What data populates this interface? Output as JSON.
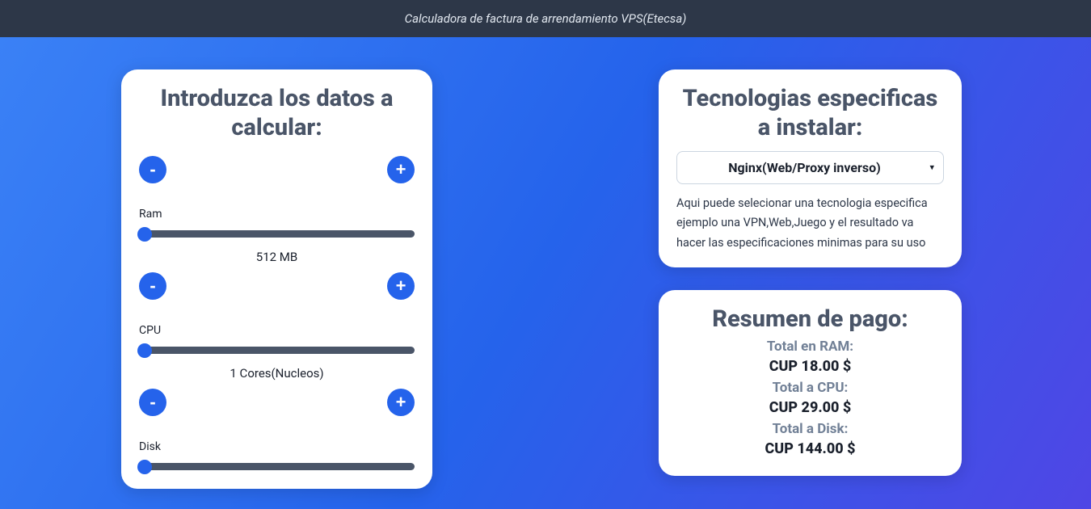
{
  "header": {
    "title": "Calculadora de factura de arrendamiento VPS(Etecsa)"
  },
  "inputPanel": {
    "heading": "Introduzca los datos a calcular:",
    "minus_label": "-",
    "plus_label": "+",
    "ram": {
      "label": "Ram",
      "value_text": "512 MB"
    },
    "cpu": {
      "label": "CPU",
      "value_text": "1 Cores(Nucleos)"
    },
    "disk": {
      "label": "Disk"
    }
  },
  "techPanel": {
    "heading": "Tecnologias especificas a instalar:",
    "selected": "Nginx(Web/Proxy inverso)",
    "description": "Aqui puede selecionar una tecnologia especifica ejemplo una VPN,Web,Juego y el resultado va hacer las especificaciones minimas para su uso"
  },
  "summaryPanel": {
    "heading": "Resumen de pago:",
    "ram_label": "Total en RAM:",
    "ram_value": "CUP 18.00 $",
    "cpu_label": "Total a CPU:",
    "cpu_value": "CUP 29.00 $",
    "disk_label": "Total a Disk:",
    "disk_value": "CUP 144.00 $"
  }
}
